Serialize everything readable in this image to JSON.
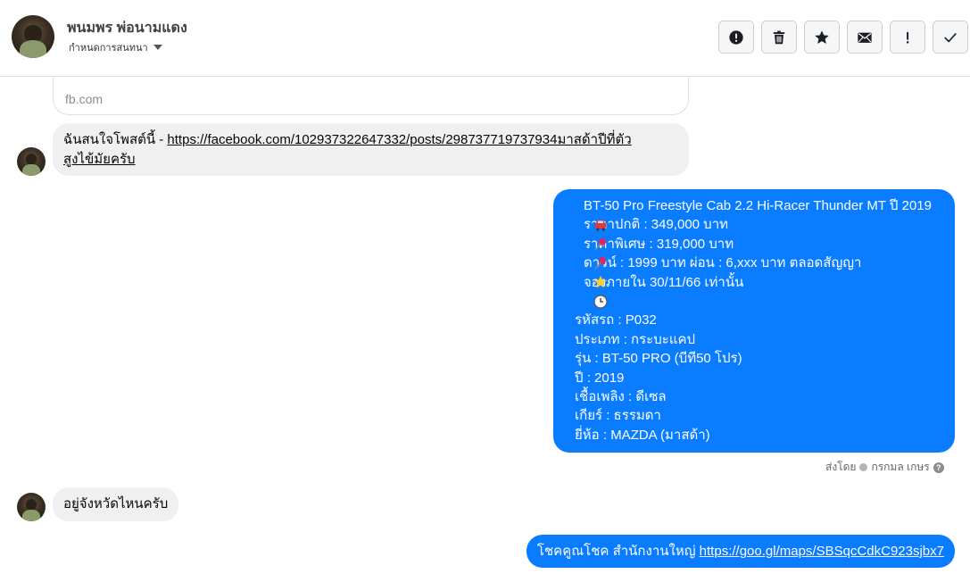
{
  "header": {
    "contact_name": "พนมพร พ่อนามแดง",
    "assign_label": "กำหนดการสนทนา",
    "toolbar": [
      {
        "name": "report-button",
        "icon": "alert-circle-icon"
      },
      {
        "name": "delete-button",
        "icon": "trash-icon"
      },
      {
        "name": "star-button",
        "icon": "star-icon"
      },
      {
        "name": "mark-unread-button",
        "icon": "envelope-icon"
      },
      {
        "name": "follow-up-button",
        "icon": "exclamation-icon"
      },
      {
        "name": "done-button",
        "icon": "check-icon"
      }
    ]
  },
  "messages": {
    "preview_domain": "fb.com",
    "incoming_1": {
      "prefix": "ฉันสนใจโพสต์นี้ - ",
      "link_line1": "https://facebook.com/102937322647332/posts/298737719737934มาสด้าปีที่ตัว",
      "link_line2": "สูงไข้มัยครับ"
    },
    "outgoing_1": {
      "title": "BT-50 Pro Freestyle Cab 2.2 Hi-Racer Thunder MT ปี 2019",
      "normal_price": "ราคาปกติ : 349,000 บาท",
      "special_price": "ราคาพิเศษ : 319,000 บาท",
      "down_payment": "ดาวน์ : 1999 บาท ผ่อน : 6,xxx บาท ตลอดสัญญา",
      "booking": "จองภายใน 30/11/66 เท่านั้น",
      "details": [
        "รหัสรถ : P032",
        "ประเภท : กระบะแคป",
        "รุ่น : BT-50 PRO (บีที50 โปร)",
        "ปี : 2019",
        "เชื้อเพลิง : ดีเซล",
        "เกียร์ : ธรรมดา",
        "ยี่ห้อ : MAZDA (มาสด้า)"
      ]
    },
    "sent_by": "ส่งโดย",
    "sender_name": "กรกมล เกษร",
    "incoming_2": "อยู่จังหวัดไหนครับ",
    "outgoing_2": {
      "text": "โชคคูณโชค สำนักงานใหญ่ ",
      "link": "https://goo.gl/maps/SBSqcCdkC923sjbx7"
    }
  },
  "colors": {
    "outgoing_bubble": "#0a7cff",
    "incoming_bubble": "#f0f0f0"
  }
}
